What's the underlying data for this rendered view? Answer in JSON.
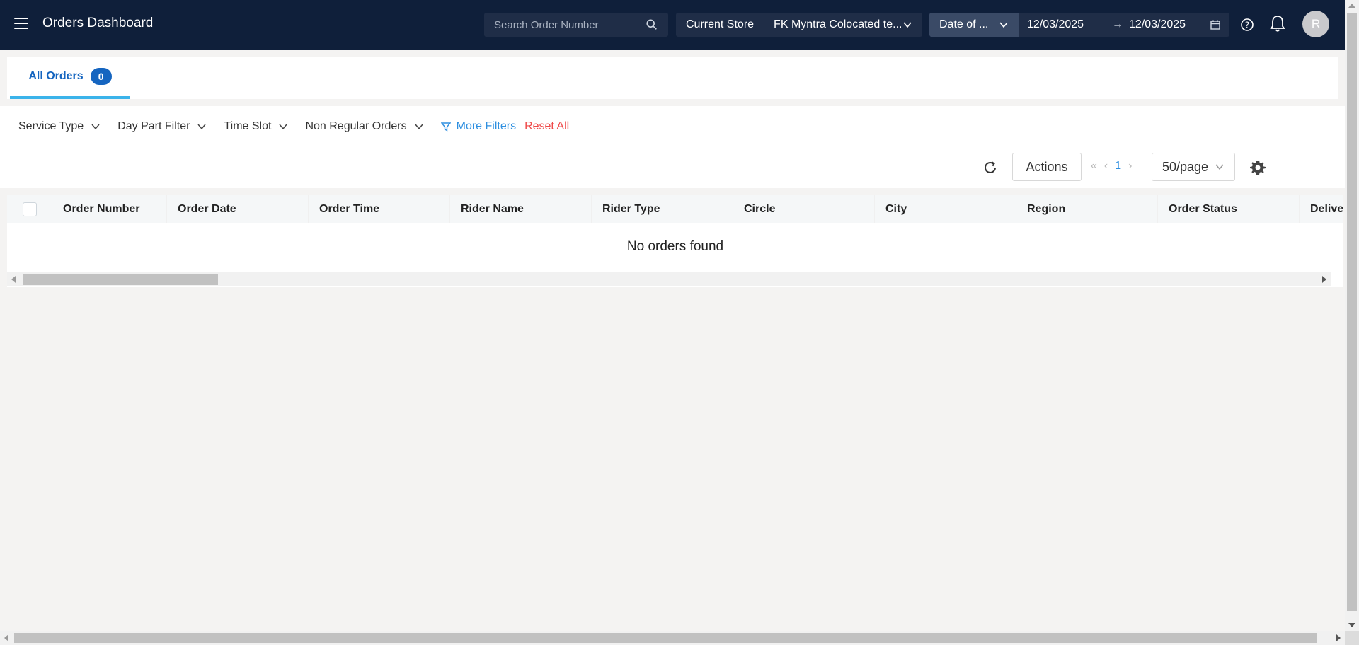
{
  "header": {
    "title": "Orders Dashboard",
    "search_placeholder": "Search Order Number",
    "store_label": "Current Store",
    "store_value": "FK Myntra Colocated te...",
    "date_type": "Date of ...",
    "date_from": "12/03/2025",
    "date_to": "12/03/2025",
    "avatar_initial": "R"
  },
  "tabs": [
    {
      "label": "All Orders",
      "count": "0"
    }
  ],
  "filters": {
    "items": [
      "Service Type",
      "Day Part Filter",
      "Time Slot",
      "Non Regular Orders"
    ],
    "more_filters": "More Filters",
    "reset_all": "Reset All"
  },
  "toolbar": {
    "actions_label": "Actions",
    "current_page": "1",
    "per_page": "50/page"
  },
  "table": {
    "columns": [
      "Order Number",
      "Order Date",
      "Order Time",
      "Rider Name",
      "Rider Type",
      "Circle",
      "City",
      "Region",
      "Order Status",
      "Delivery"
    ],
    "empty_message": "No orders found"
  },
  "colors": {
    "header_bg": "#0f1f3a",
    "accent": "#1565c0",
    "tab_underline": "#3bb3ea",
    "link": "#2e8fe0",
    "danger": "#ef4a4a"
  },
  "icons": [
    "hamburger-icon",
    "search-icon",
    "chevron-down-icon",
    "calendar-icon",
    "help-icon",
    "bell-icon",
    "filter-icon",
    "refresh-icon",
    "first-page-icon",
    "prev-page-icon",
    "next-page-icon",
    "gear-icon"
  ]
}
